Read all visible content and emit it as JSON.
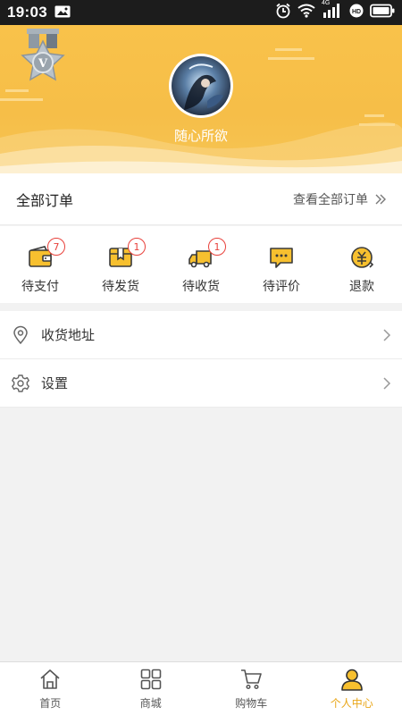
{
  "status_bar": {
    "time": "19:03",
    "network": "4G"
  },
  "colors": {
    "accent": "#F6BE48",
    "badge": "#E8413B",
    "active_tab": "#E9A617"
  },
  "profile": {
    "username": "随心所欲",
    "badge_letter": "V"
  },
  "orders": {
    "title": "全部订单",
    "view_all": "查看全部订单",
    "items": [
      {
        "label": "待支付",
        "icon": "wallet-icon",
        "badge": "7"
      },
      {
        "label": "待发货",
        "icon": "package-icon",
        "badge": "1"
      },
      {
        "label": "待收货",
        "icon": "truck-icon",
        "badge": "1"
      },
      {
        "label": "待评价",
        "icon": "comment-icon",
        "badge": ""
      },
      {
        "label": "退款",
        "icon": "refund-icon",
        "badge": ""
      }
    ]
  },
  "menu": [
    {
      "label": "收货地址",
      "icon": "location-pin-icon"
    },
    {
      "label": "设置",
      "icon": "gear-icon"
    }
  ],
  "tabbar": [
    {
      "label": "首页",
      "icon": "home-icon"
    },
    {
      "label": "商城",
      "icon": "grid-icon"
    },
    {
      "label": "购物车",
      "icon": "cart-icon"
    },
    {
      "label": "个人中心",
      "icon": "person-icon",
      "active": true
    }
  ]
}
